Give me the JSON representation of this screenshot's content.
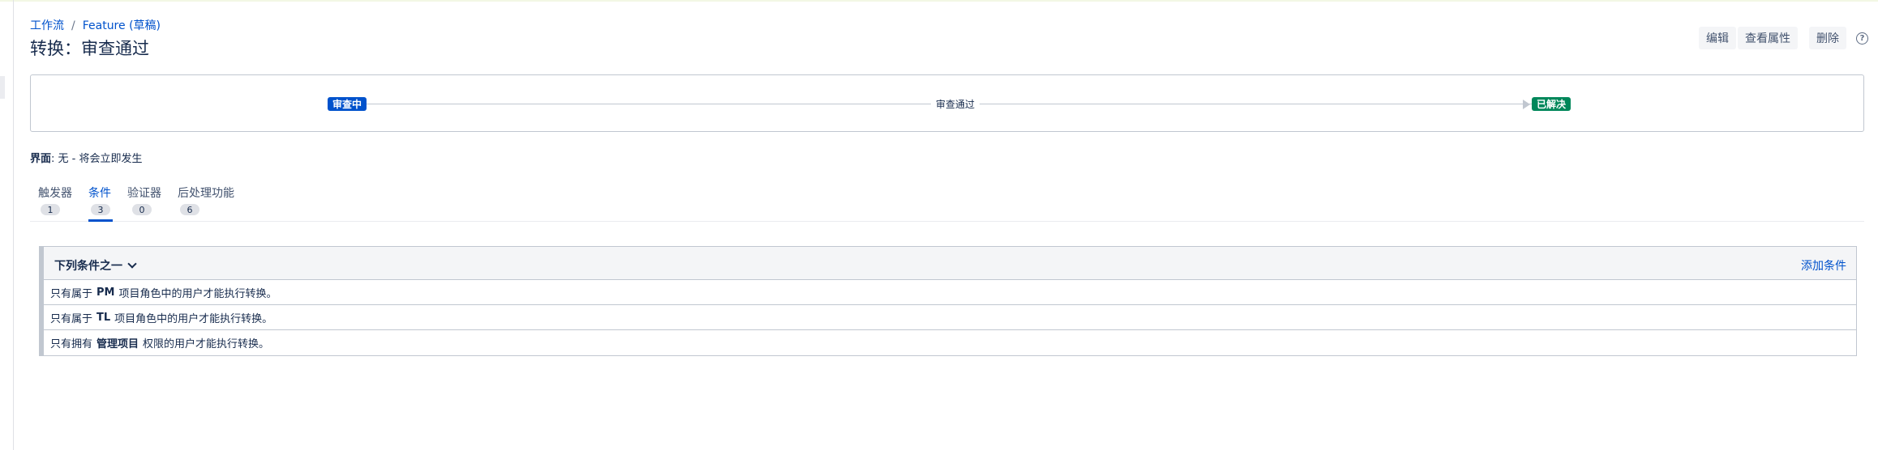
{
  "breadcrumb": {
    "workflows": "工作流",
    "separator": "/",
    "workflow": "Feature (草稿)"
  },
  "page_title": "转换：审查通过",
  "actions": {
    "edit": "编辑",
    "view_properties": "查看属性",
    "delete": "删除",
    "help": "?"
  },
  "diagram": {
    "from_status": "审查中",
    "transition": "审查通过",
    "to_status": "已解决"
  },
  "screen": {
    "label": "界面",
    "value": ": 无 - 将会立即发生"
  },
  "tabs": [
    {
      "label": "触发器",
      "count": "1"
    },
    {
      "label": "条件",
      "count": "3"
    },
    {
      "label": "验证器",
      "count": "0"
    },
    {
      "label": "后处理功能",
      "count": "6"
    }
  ],
  "conditions": {
    "group_label": "下列条件之一",
    "add_label": "添加条件",
    "rows": [
      {
        "prefix": "只有属于",
        "bold": "PM",
        "suffix": "项目角色中的用户才能执行转换。"
      },
      {
        "prefix": "只有属于",
        "bold": "TL",
        "suffix": "项目角色中的用户才能执行转换。"
      },
      {
        "prefix": "只有拥有",
        "bold": "管理项目",
        "suffix": "权限的用户才能执行转换。"
      }
    ]
  },
  "colors": {
    "link": "#0052cc",
    "status_in_progress": "#0052cc",
    "status_done": "#00875a"
  }
}
